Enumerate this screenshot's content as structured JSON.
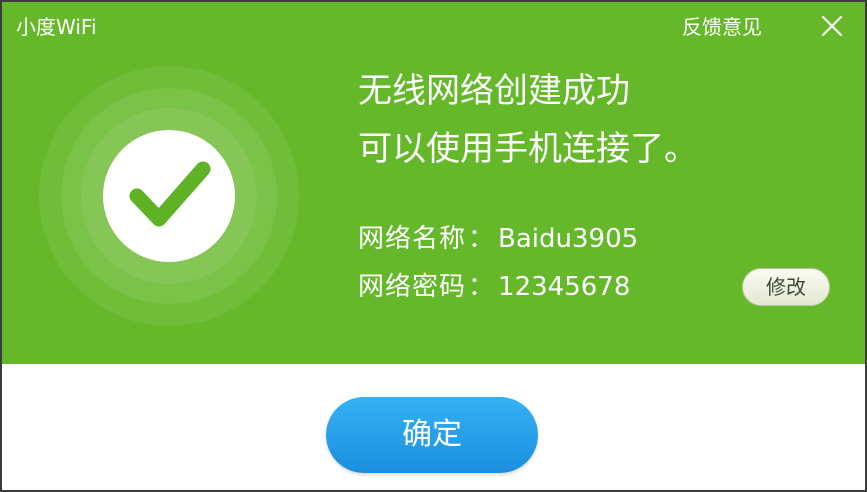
{
  "window": {
    "app_title": "小度WiFi",
    "feedback_label": "反馈意见"
  },
  "status": {
    "icon": "checkmark-icon",
    "line1": "无线网络创建成功",
    "line2": "可以使用手机连接了。"
  },
  "network": {
    "name_label": "网络名称",
    "name_value": "Baidu3905",
    "password_label": "网络密码",
    "password_value": "12345678",
    "separator": "：",
    "modify_label": "修改"
  },
  "actions": {
    "confirm_label": "确定"
  },
  "colors": {
    "panel_green": "#66b82b",
    "check_green": "#5fb226",
    "confirm_blue": "#2aa0ec"
  }
}
